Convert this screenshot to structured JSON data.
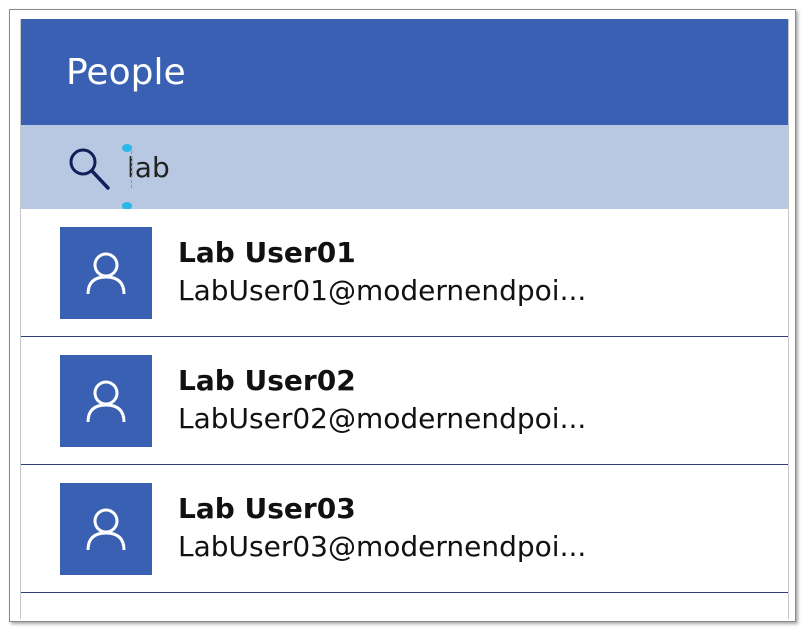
{
  "header": {
    "title": "People"
  },
  "search": {
    "value": "lab",
    "icon": "search-icon"
  },
  "colors": {
    "header": "#3a60b4",
    "searchbar": "#b8c8e3",
    "avatar": "#3a60b4",
    "divider": "#2e3f7c",
    "selection_handle": "#29b8e8"
  },
  "people": [
    {
      "name": "Lab User01",
      "email": "LabUser01@modernendpoi...",
      "icon": "person-icon"
    },
    {
      "name": "Lab User02",
      "email": "LabUser02@modernendpoi...",
      "icon": "person-icon"
    },
    {
      "name": "Lab User03",
      "email": "LabUser03@modernendpoi...",
      "icon": "person-icon"
    }
  ]
}
